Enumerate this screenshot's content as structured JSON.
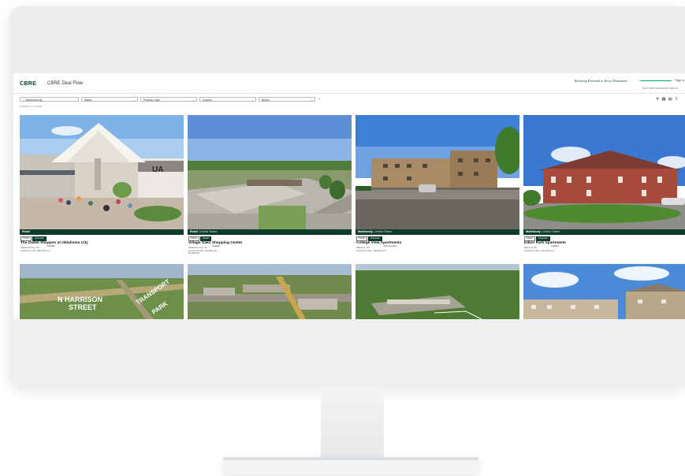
{
  "header": {
    "logo": "CBRE",
    "app_title": "CBRE Deal Flow",
    "tagline": "Realizing Potential in Every Dimension",
    "tag_link": "Sign in",
    "sub_link": "Don't have an account? Sign up"
  },
  "filters": {
    "search_value": "Oklahoma city",
    "status": "Status",
    "property_type": "Property Type",
    "country": "Country",
    "broker": "Broker"
  },
  "results_label": "8 ASSETS LISTED",
  "cards": [
    {
      "banner_type": "Retail",
      "banner_loc": "",
      "chips": [
        "Details",
        "Financials",
        "Available"
      ],
      "title": "The Outlet Shoppes at Oklahoma City",
      "line1": "Oklahoma City, OK",
      "line2": "Investment Size: $84,000 sq ft",
      "line3": ""
    },
    {
      "banner_type": "Retail",
      "banner_loc": "| United States",
      "chips": [
        "Details",
        "Details",
        "Available"
      ],
      "title": "Village Oaks Shopping Center",
      "line1": "Oklahoma City, OK",
      "line2": "Investment Size: $4,000 sq ft",
      "line3": "$4,000,000"
    },
    {
      "banner_type": "Multifamily",
      "banner_loc": "| United States",
      "chips": [
        "Details",
        "Financials"
      ],
      "chip_note": "Under Contract",
      "title": "College View Apartments",
      "line1": "Stillwater, OK",
      "line2": "Investment Size: 185,000 sq ft",
      "line3": ""
    },
    {
      "banner_type": "Multifamily",
      "banner_loc": "| United States",
      "chips": [
        "Details",
        "Financials",
        "Available"
      ],
      "title": "Dillon Park Apartments",
      "line1": "Edmond, OK",
      "line2": "Investment Size: 166,000 sq ft",
      "line3": ""
    }
  ],
  "row2_labels": {
    "street": "N HARRISON",
    "street2": "STREET",
    "parkway": "TRANSPORT",
    "parkway2": "PARK"
  },
  "icons": {
    "filter": "filter-icon",
    "grid": "grid-view-icon",
    "list": "list-view-icon",
    "share": "share-icon"
  }
}
